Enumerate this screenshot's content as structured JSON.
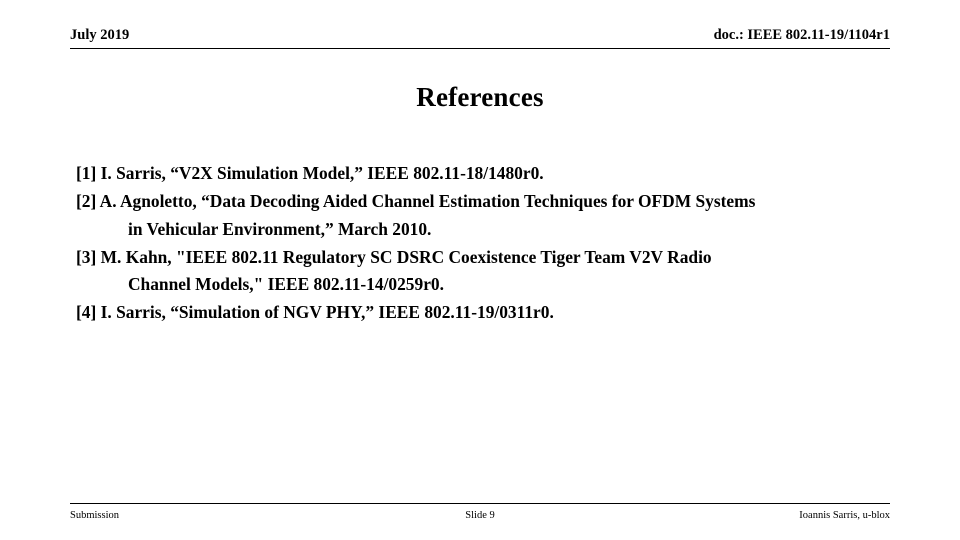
{
  "header": {
    "left": "July 2019",
    "right": "doc.: IEEE 802.11-19/1104r1"
  },
  "title": "References",
  "references": [
    {
      "marker": "[1]",
      "line1": "[1] I. Sarris, “V2X Simulation Model,” IEEE 802.11-18/1480r0.",
      "line2": ""
    },
    {
      "marker": "[2]",
      "line1": "[2] A. Agnoletto, “Data Decoding Aided Channel Estimation Techniques for OFDM Systems",
      "line2": "in Vehicular Environment,” March 2010."
    },
    {
      "marker": "[3]",
      "line1": "[3] M. Kahn, \"IEEE 802.11 Regulatory SC DSRC Coexistence Tiger Team V2V Radio",
      "line2": "Channel Models,\" IEEE 802.11-14/0259r0."
    },
    {
      "marker": "[4]",
      "line1": "[4] I. Sarris, “Simulation of NGV PHY,” IEEE 802.11-19/0311r0.",
      "line2": ""
    }
  ],
  "footer": {
    "left": "Submission",
    "center": "Slide 9",
    "right": "Ioannis Sarris, u-blox"
  },
  "colors": {
    "text": "#000000",
    "background": "#ffffff",
    "rule": "#000000"
  }
}
